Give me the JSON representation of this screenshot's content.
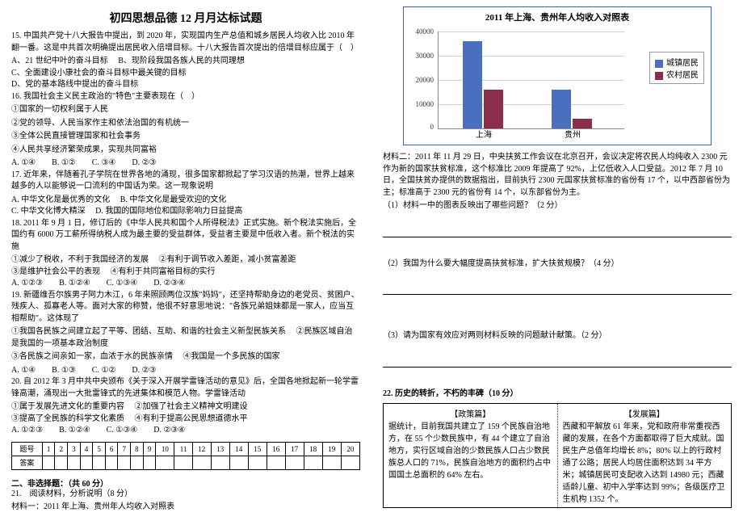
{
  "title": "初四思想品德 12 月月达标试题",
  "q15": "15. 中国共产党十八大报告中提出，到 2020 年，实现国内生产总值和城乡居民人均收入比 2010 年翻一番。这是中共首次明确提出居民收入倍增目标。十八大报告首次提出的倍增目标应属于（　）",
  "q15a": "A、21 世纪中叶的奋斗目标",
  "q15b": "B、现阶段我国各族人民的共同理想",
  "q15c": "C、全面建设小康社会的奋斗目标中最关键的目标",
  "q15d": "D、党的基本路线中提出的奋斗目标",
  "q16": "16. 我国社会主义民主政治的\"特色\"主要表现在（　）",
  "q16_1": "①国家的一切权利属于人民",
  "q16_2": "②党的领导、人民当家作主和依法治国的有机统一",
  "q16_3": "③全体公民直接管理国家和社会事务",
  "q16_4": "④人民共享经济繁荣成果，实现共同富裕",
  "q16opts": "A. ①④　　B. ①②　　C. ③④　　D. ②③",
  "q17": "17. 近年来，伴随着孔子学院在世界各地的涌现，很多国家都掀起了学习汉语的热潮，世界上越来越多的人以能够说一口流利的中国话为荣。这一现象说明",
  "q17a": "A. 中华文化是最优秀的文化",
  "q17b": "B. 中华文化是最受欢迎的文化",
  "q17c": "C. 中华文化博大精深",
  "q17d": "D. 我国的国际地位和国际影响力日益提高",
  "q18": "18. 2011 年 9 月 1 日，修订后的《中华人民共和国个人所得税法》正式实施。新个税法实施后，全国约有 6000 万工薪所得纳税人成为最主要的受益群体，受益者主要是中低收入者。新个税法的实施",
  "q18_1": "①减少了税收，不利于我国经济的发展",
  "q18_2": "②有利于调节收入差距，减小贫富差距",
  "q18_3": "③是维护社会公平的表现",
  "q18_4": "④有利于共同富裕目标的实行",
  "q18opts": "A. ①②③　　B. ①②④　　C. ①③④　　D. ②③④",
  "q19": "19. 新疆维吾尔族男子阿力木江，6 年来照顾两位汉族\"妈妈\"，还坚持帮助身边的老党员、贫困户、残疾人、孤寡老人等。面对大家的称赞，他很不好意思地说：\"各族兄弟姐妹都是一家人，应当互相帮助\"。这体现了",
  "q19_1": "①我国各民族之间建立起了平等、团结、互助、和谐的社会主义新型民族关系",
  "q19_2": "②民族区域自治是我国的一项基本政治制度",
  "q19_3": "③各民族之间亲如一家，血浓于水的民族亲情",
  "q19_4": "④我国是一个多民族的国家",
  "q19opts": "A. ①④　　B. ①③　　C. ①②　　D. ②③",
  "q20": "20. 自 2012 年 3 月中共中央颁布《关于深入开展学雷锋活动的意见》后，全国各地掀起新一轮学雷锋高潮，涌现出一大批雷锋式的先进集体和模范人物。学雷锋活动",
  "q20_1": "①属于发展先进文化的重要内容",
  "q20_2": "②加强了社会主义精神文明建设",
  "q20_3": "③提高了全民族的科学文化素质",
  "q20_4": "④有利于提高公民思想道德水平",
  "q20opts": "A. ①②③　　B. ①②④　　C. ①③④　　D. ②③④",
  "tbl_row": "题号",
  "tbl_ans": "答案",
  "sec2": "二、非选择题：（共 60 分）",
  "q21": "21.　阅读材料，分析说明（8 分）",
  "q21m1": "材料一：2011 年上海、贵州年人均收入对照表",
  "q21m2": "材料二：2011 年 11 月 29 日，中央扶贫工作会议在北京召开，会议决定将农民人均纯收入 2300 元作为新的国家扶贫标准，这个标准比 2009 年提高了 92%，上亿低收入人口受益。2012 年 7 月 10 日，全国扶贫办提供的数据指出，目前执行 2300 元国家扶贫标准的省份有 17 个，以中西部省份为主；标准高于 2300 元的省份有 14 个，以东部省份为主。",
  "q21_1": "（1）材料一中的图表反映出了哪些问题？（2 分）",
  "q21_2": "（2）我国为什么要大幅度提高扶贫标准，扩大扶贫规模？（4 分）",
  "q21_3": "（3）请为国家有效应对两则材料反映的问题献计献策。（2 分）",
  "q22": "22. 历史的转折，不朽的丰碑（10 分）",
  "box_left_head": "【政策篇】",
  "box_right_head": "【发展篇】",
  "box_left": "据统计，目前我国共建立了 159 个民族自治地方，在 55 个少数民族中，有 44 个建立了自治地方，实行区域自治的少数民族人口占少数民族总人口的 71%，民族自治地方的面积约占中国国土总面积的 64% 左右。",
  "box_right": "西藏和平解放 61 年来，党和政府非常重视西藏的发展，在各个方面都取得了巨大成就。国民生产总值年均增长 8%；80% 以上的行政村通了公路；居民人均居住面积达到 34 平方米；城镇居民可支配收入达到 14980 元；西藏适龄儿童、初中入学率达到 99%；各级医疗卫生机构 1352 个。",
  "chart_data": {
    "type": "bar",
    "title": "2011 年上海、贵州年人均收入对照表",
    "categories": [
      "上海",
      "贵州"
    ],
    "series": [
      {
        "name": "城镇居民",
        "values": [
          36000,
          16000
        ]
      },
      {
        "name": "农村居民",
        "values": [
          16000,
          4000
        ]
      }
    ],
    "ylabel": "",
    "ylim": [
      0,
      40000
    ],
    "yticks": [
      0,
      10000,
      20000,
      30000,
      40000
    ],
    "legend": [
      "城镇居民",
      "农村居民"
    ]
  }
}
